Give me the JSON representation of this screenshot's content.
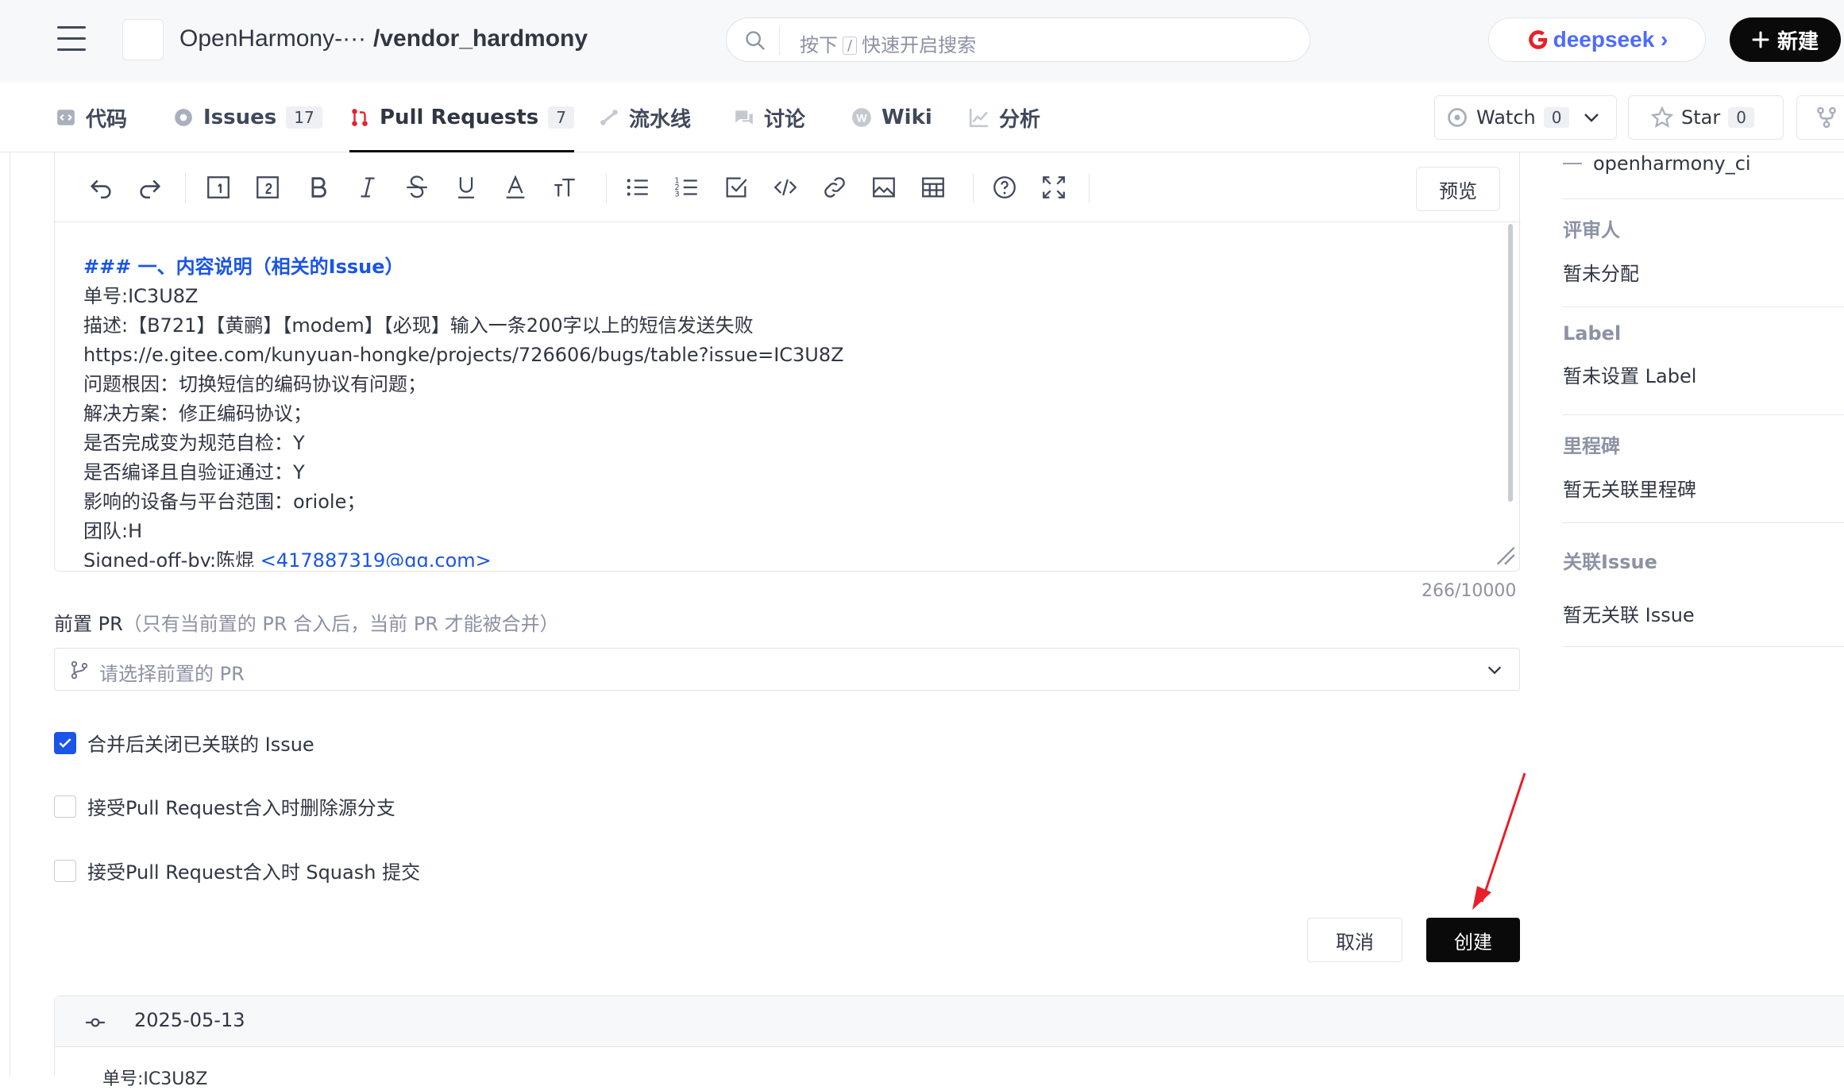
{
  "header": {
    "repo_owner": "OpenHarmony-···",
    "repo_name": "/vendor_hardmony",
    "search": {
      "prefix": "按下",
      "key": "/",
      "suffix": "快速开启搜索"
    },
    "deepseek_label": "deepseek ›",
    "new_button": "新建"
  },
  "tabs": [
    {
      "label": "代码",
      "count": null
    },
    {
      "label": "Issues",
      "count": "17"
    },
    {
      "label": "Pull Requests",
      "count": "7"
    },
    {
      "label": "流水线",
      "count": null
    },
    {
      "label": "讨论",
      "count": null
    },
    {
      "label": "Wiki",
      "count": null
    },
    {
      "label": "分析",
      "count": null
    }
  ],
  "repo_actions": {
    "watch_label": "Watch",
    "watch_count": "0",
    "star_label": "Star",
    "star_count": "0"
  },
  "editor": {
    "preview_label": "预览",
    "heading": "### 一、内容说明（相关的Issue）",
    "lines": [
      "单号:IC3U8Z",
      "描述:【B721】【黄鹂】【modem】【必现】输入一条200字以上的短信发送失败",
      "https://e.gitee.com/kunyuan-hongke/projects/726606/bugs/table?issue=IC3U8Z",
      "问题根因：切换短信的编码协议有问题；",
      "解决方案：修正编码协议；",
      "是否完成变为规范自检：Y",
      "是否编译且自验证通过：Y",
      "影响的设备与平台范围：oriole；",
      "团队:H"
    ],
    "signoff_prefix": "Signed-off-by:陈焜 ",
    "signoff_email": "<417887319@qq.com>",
    "char_count": "266/10000"
  },
  "prereq": {
    "label": "前置 PR",
    "hint": "（只有当前置的 PR 合入后，当前 PR 才能被合并）",
    "placeholder": "请选择前置的 PR"
  },
  "options": [
    {
      "label": "合并后关闭已关联的 Issue",
      "checked": true
    },
    {
      "label": "接受Pull Request合入时删除源分支",
      "checked": false
    },
    {
      "label": "接受Pull Request合入时 Squash 提交",
      "checked": false
    }
  ],
  "buttons": {
    "cancel": "取消",
    "create": "创建"
  },
  "commits": {
    "date": "2025-05-13",
    "first_message": "单号:IC3U8Z"
  },
  "sidebar": {
    "ci_user": "openharmony_ci",
    "reviewers_title": "评审人",
    "reviewers_value": "暂未分配",
    "label_title": "Label",
    "label_value": "暂未设置 Label",
    "milestone_title": "里程碑",
    "milestone_value": "暂无关联里程碑",
    "issue_title": "关联Issue",
    "issue_value": "暂无关联 Issue"
  },
  "colors": {
    "accent": "#1a54e8",
    "primary_button": "#0a0a0a",
    "annotation_arrow": "#e8202a",
    "deepseek": "#4d6bfe"
  }
}
